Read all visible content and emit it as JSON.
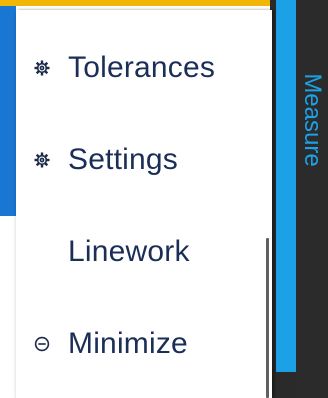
{
  "menu": {
    "items": [
      {
        "label": "Tolerances",
        "icon": "gear-icon"
      },
      {
        "label": "Settings",
        "icon": "gear-icon"
      },
      {
        "label": "Linework",
        "icon": ""
      },
      {
        "label": "Minimize",
        "icon": "minus-circle-icon"
      }
    ]
  },
  "side_tab": {
    "label": "Measure"
  },
  "colors": {
    "menu_text": "#1b2e57",
    "tab_accent": "#1da1e6",
    "tab_background": "#2b2b2b",
    "top_bar": "#f2b705"
  }
}
